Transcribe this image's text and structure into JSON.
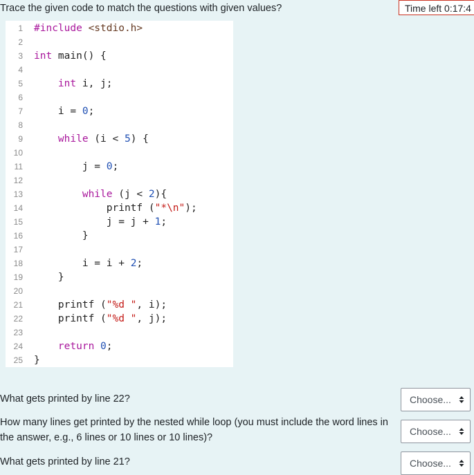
{
  "header": {
    "prompt": "Trace the given code to match the questions with given values?",
    "timer": "Time left 0:17:4"
  },
  "code": {
    "lines": [
      {
        "n": "1",
        "html": "<span class=\"kw\">#include</span> <span class=\"inc\">&lt;stdio.h&gt;</span>"
      },
      {
        "n": "2",
        "html": ""
      },
      {
        "n": "3",
        "html": "<span class=\"kw\">int</span> main() {"
      },
      {
        "n": "4",
        "html": ""
      },
      {
        "n": "5",
        "html": "    <span class=\"kw\">int</span> i, j;"
      },
      {
        "n": "6",
        "html": ""
      },
      {
        "n": "7",
        "html": "    i = <span class=\"num\">0</span>;"
      },
      {
        "n": "8",
        "html": ""
      },
      {
        "n": "9",
        "html": "    <span class=\"kw\">while</span> (i &lt; <span class=\"num\">5</span>) {"
      },
      {
        "n": "10",
        "html": ""
      },
      {
        "n": "11",
        "html": "        j = <span class=\"num\">0</span>;"
      },
      {
        "n": "12",
        "html": ""
      },
      {
        "n": "13",
        "html": "        <span class=\"kw\">while</span> (j &lt; <span class=\"num\">2</span>){"
      },
      {
        "n": "14",
        "html": "            printf (<span class=\"str\">\"*\\n\"</span>);"
      },
      {
        "n": "15",
        "html": "            j = j + <span class=\"num\">1</span>;"
      },
      {
        "n": "16",
        "html": "        }"
      },
      {
        "n": "17",
        "html": ""
      },
      {
        "n": "18",
        "html": "        i = i + <span class=\"num\">2</span>;"
      },
      {
        "n": "19",
        "html": "    }"
      },
      {
        "n": "20",
        "html": ""
      },
      {
        "n": "21",
        "html": "    printf (<span class=\"str\">\"%d \"</span>, i);"
      },
      {
        "n": "22",
        "html": "    printf (<span class=\"str\">\"%d \"</span>, j);"
      },
      {
        "n": "23",
        "html": ""
      },
      {
        "n": "24",
        "html": "    <span class=\"kw\">return</span> <span class=\"num\">0</span>;"
      },
      {
        "n": "25",
        "html": "}"
      }
    ]
  },
  "questions": [
    {
      "text": "What gets printed by line 22?",
      "select": "Choose..."
    },
    {
      "text": "How many lines get printed by the nested while loop (you must include the word lines in the answer, e.g., 6 lines or 10 lines or 10 lines)?",
      "select": "Choose..."
    },
    {
      "text": "What gets printed by line 21?",
      "select": "Choose..."
    }
  ]
}
